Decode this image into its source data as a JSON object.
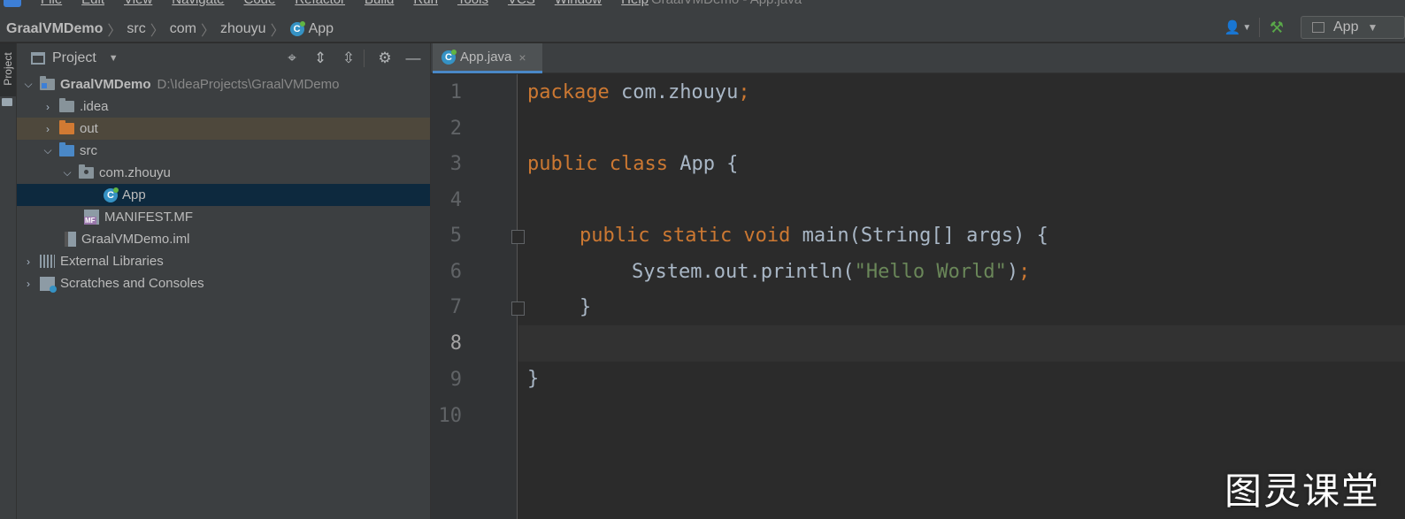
{
  "menubar": {
    "items": [
      "File",
      "Edit",
      "View",
      "Navigate",
      "Code",
      "Refactor",
      "Build",
      "Run",
      "Tools",
      "VCS",
      "Window",
      "Help"
    ],
    "window_title": "GraalVMDemo - App.java"
  },
  "navbar": {
    "breadcrumbs": [
      "GraalVMDemo",
      "src",
      "com",
      "zhouyu",
      "App"
    ],
    "run_config": "App"
  },
  "stripe": {
    "project_tab": "Project"
  },
  "project_panel": {
    "title": "Project",
    "tree": [
      {
        "label": "GraalVMDemo",
        "hint": "D:\\IdeaProjects\\GraalVMDemo",
        "expanded": true
      },
      {
        "label": ".idea",
        "expanded": false
      },
      {
        "label": "out",
        "expanded": false
      },
      {
        "label": "src",
        "expanded": true
      },
      {
        "label": "com.zhouyu",
        "expanded": true
      },
      {
        "label": "App",
        "selected": true
      },
      {
        "label": "MANIFEST.MF"
      },
      {
        "label": "GraalVMDemo.iml"
      },
      {
        "label": "External Libraries",
        "expanded": false
      },
      {
        "label": "Scratches and Consoles",
        "expanded": false
      }
    ]
  },
  "editor": {
    "tab": {
      "label": "App.java",
      "close": "×"
    },
    "line_numbers": [
      "1",
      "2",
      "3",
      "4",
      "5",
      "6",
      "7",
      "8",
      "9",
      "10"
    ],
    "current_line": "8",
    "code": {
      "l1_kw": "package",
      "l1_rest": " com.zhouyu",
      "l1_semi": ";",
      "l3_kw": "public class",
      "l3_rest": " App {",
      "l5_kw": "public static void",
      "l5_rest": " main(String[] args) {",
      "l6_pre": "System.out.println(",
      "l6_str": "\"Hello World\"",
      "l6_close": ")",
      "l6_semi": ";",
      "l7": "}",
      "l9": "}"
    }
  },
  "colors": {
    "keyword": "#cc7832",
    "string": "#6a8759",
    "plain": "#a9b7c6",
    "selection": "#0d293e"
  },
  "watermark": "图灵课堂"
}
